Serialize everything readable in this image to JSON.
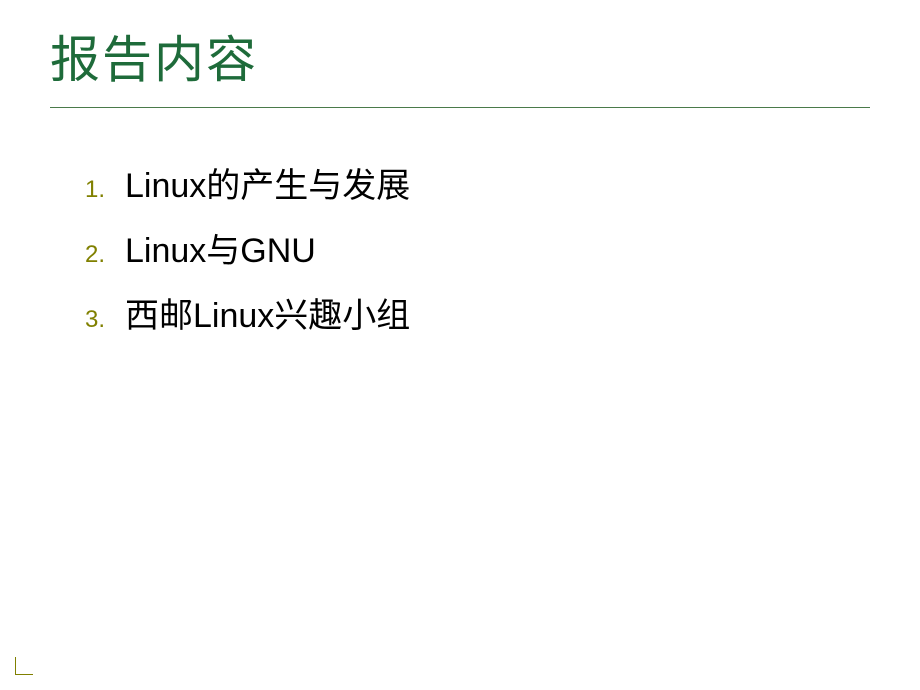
{
  "slide": {
    "title": "报告内容",
    "items": [
      {
        "number": "1.",
        "text": "Linux的产生与发展"
      },
      {
        "number": "2.",
        "text": "Linux与GNU"
      },
      {
        "number": "3.",
        "text": "西邮Linux兴趣小组"
      }
    ]
  }
}
